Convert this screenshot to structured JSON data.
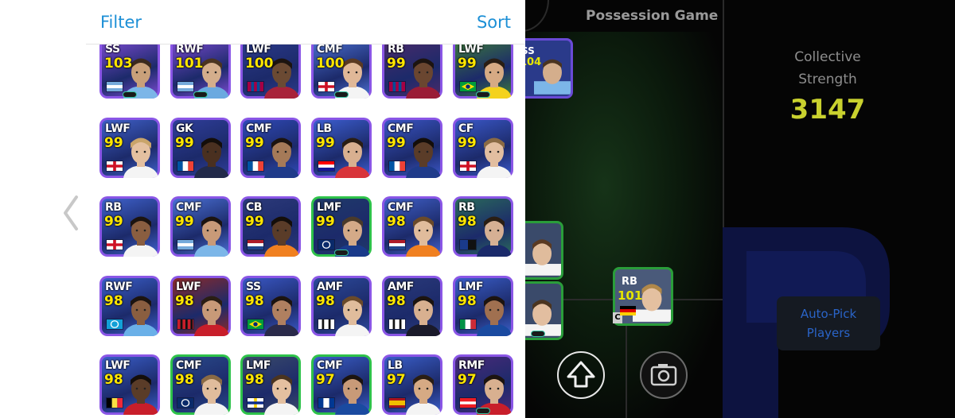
{
  "panel": {
    "filter_label": "Filter",
    "sort_label": "Sort",
    "cards": [
      {
        "pos": "SS",
        "rating": "103",
        "flag": "argentina",
        "bg": "#7a4ad0",
        "border": "#8a56e6",
        "skin": "#c9a07a",
        "hair": "#3b2a1e",
        "shirt": "#7cb6e8",
        "badge": true
      },
      {
        "pos": "RWF",
        "rating": "101",
        "flag": "argentina",
        "bg": "#7a4ad0",
        "border": "#8a56e6",
        "skin": "#d4ae8c",
        "hair": "#4a3420",
        "shirt": "#6aa9e0",
        "badge": true
      },
      {
        "pos": "LWF",
        "rating": "100",
        "flag": "barcelona",
        "bg": "#2b3a8a",
        "border": "#8a56e6",
        "skin": "#6b4a33",
        "hair": "#1c1410",
        "shirt": "#a8223a",
        "badge": false
      },
      {
        "pos": "CMF",
        "rating": "100",
        "flag": "england",
        "bg": "#4b6fd0",
        "border": "#8a56e6",
        "skin": "#e0b898",
        "hair": "#5a3a22",
        "shirt": "#f4f4f4",
        "badge": true
      },
      {
        "pos": "RB",
        "rating": "99",
        "flag": "barcelona",
        "bg": "#4a2a6a",
        "border": "#8a56e6",
        "skin": "#6a4630",
        "hair": "#1c1410",
        "shirt": "#9a1c36",
        "badge": false
      },
      {
        "pos": "LWF",
        "rating": "99",
        "flag": "brazil",
        "bg": "#3c7a3a",
        "border": "#8a56e6",
        "skin": "#d6aa84",
        "hair": "#2a1e14",
        "shirt": "#f4d21c",
        "badge": true
      },
      {
        "pos": "LWF",
        "rating": "99",
        "flag": "england",
        "bg": "#3f60c8",
        "border": "#8a56e6",
        "skin": "#e4c0a0",
        "hair": "#c9a46a",
        "shirt": "#f4f4f4",
        "badge": false
      },
      {
        "pos": "GK",
        "rating": "99",
        "flag": "france",
        "bg": "#2f3e9a",
        "border": "#8a56e6",
        "skin": "#4a3020",
        "hair": "#140e0a",
        "shirt": "#222a4a",
        "badge": false
      },
      {
        "pos": "CMF",
        "rating": "99",
        "flag": "france",
        "bg": "#2f4ab8",
        "border": "#8a56e6",
        "skin": "#a57a58",
        "hair": "#1c1410",
        "shirt": "#1f3b8a",
        "badge": false
      },
      {
        "pos": "LB",
        "rating": "99",
        "flag": "croatia",
        "bg": "#3c5ed0",
        "border": "#8a56e6",
        "skin": "#d8b090",
        "hair": "#2a1e14",
        "shirt": "#d8343a",
        "badge": false
      },
      {
        "pos": "CMF",
        "rating": "99",
        "flag": "france",
        "bg": "#3a55c4",
        "border": "#8a56e6",
        "skin": "#5a3c28",
        "hair": "#140e0a",
        "shirt": "#1f3b8a",
        "badge": false
      },
      {
        "pos": "CF",
        "rating": "99",
        "flag": "england",
        "bg": "#3a58c8",
        "border": "#8a56e6",
        "skin": "#e2bea0",
        "hair": "#8a6a44",
        "shirt": "#f4f4f4",
        "badge": false
      },
      {
        "pos": "RB",
        "rating": "99",
        "flag": "england",
        "bg": "#3f62cc",
        "border": "#8a56e6",
        "skin": "#8a5e40",
        "hair": "#1c1410",
        "shirt": "#f4f4f4",
        "badge": false
      },
      {
        "pos": "CMF",
        "rating": "99",
        "flag": "argentina",
        "bg": "#4a70d4",
        "border": "#8a56e6",
        "skin": "#c89a78",
        "hair": "#1c1410",
        "shirt": "#7cb6e8",
        "badge": false
      },
      {
        "pos": "CB",
        "rating": "99",
        "flag": "netherlands",
        "bg": "#2c3a7a",
        "border": "#8a56e6",
        "skin": "#5a3c28",
        "hair": "#140e0a",
        "shirt": "#f08020",
        "badge": false
      },
      {
        "pos": "LMF",
        "rating": "99",
        "flag": "inter",
        "bg": "#203a6a",
        "border": "#2ec24a",
        "skin": "#d4aa88",
        "hair": "#4a3a2a",
        "shirt": "#1a3a8a",
        "badge": true
      },
      {
        "pos": "CMF",
        "rating": "98",
        "flag": "netherlands",
        "bg": "#4060c8",
        "border": "#8a56e6",
        "skin": "#e0bc9c",
        "hair": "#6a4a2a",
        "shirt": "#f08020",
        "badge": false
      },
      {
        "pos": "RB",
        "rating": "98",
        "flag": "atalanta",
        "bg": "#2a6a5a",
        "border": "#8a56e6",
        "skin": "#d6b094",
        "hair": "#2a1e14",
        "shirt": "#1a2a6a",
        "badge": false
      },
      {
        "pos": "RWF",
        "rating": "98",
        "flag": "napoli",
        "bg": "#3a5ec8",
        "border": "#8a56e6",
        "skin": "#8a5e40",
        "hair": "#1c1410",
        "shirt": "#6ab0e8",
        "badge": false
      },
      {
        "pos": "LWF",
        "rating": "98",
        "flag": "milan",
        "bg": "#8a2a2a",
        "border": "#8a56e6",
        "skin": "#c89a78",
        "hair": "#2a1e14",
        "shirt": "#c81e2a",
        "badge": false
      },
      {
        "pos": "SS",
        "rating": "98",
        "flag": "brazil",
        "bg": "#3a58c4",
        "border": "#8a56e6",
        "skin": "#b08060",
        "hair": "#1c1410",
        "shirt": "#2a2a4a",
        "badge": false
      },
      {
        "pos": "AMF",
        "rating": "98",
        "flag": "udinese",
        "bg": "#2c4a9a",
        "border": "#8a56e6",
        "skin": "#e0bc9c",
        "hair": "#6a4a2a",
        "shirt": "#f4f4f4",
        "badge": false
      },
      {
        "pos": "AMF",
        "rating": "98",
        "flag": "udinese",
        "bg": "#2a3a7a",
        "border": "#8a56e6",
        "skin": "#d8b090",
        "hair": "#1c1410",
        "shirt": "#1a1a2a",
        "badge": false
      },
      {
        "pos": "LMF",
        "rating": "98",
        "flag": "italy",
        "bg": "#3a5ec8",
        "border": "#8a56e6",
        "skin": "#a07050",
        "hair": "#1c1410",
        "shirt": "#1a4aa0",
        "badge": false
      },
      {
        "pos": "LWF",
        "rating": "98",
        "flag": "belgium",
        "bg": "#3a5ec8",
        "border": "#8a56e6",
        "skin": "#5a3c28",
        "hair": "#140e0a",
        "shirt": "#c81e2a",
        "badge": false
      },
      {
        "pos": "CMF",
        "rating": "98",
        "flag": "inter",
        "bg": "#2a4a8a",
        "border": "#2ec24a",
        "skin": "#e0bc9c",
        "hair": "#8a6a44",
        "shirt": "#f4f4f4",
        "badge": false
      },
      {
        "pos": "LMF",
        "rating": "98",
        "flag": "parma",
        "bg": "#3a4a6a",
        "border": "#2ec24a",
        "skin": "#e4c0a0",
        "hair": "#4a3420",
        "shirt": "#f4f4f4",
        "badge": false
      },
      {
        "pos": "CMF",
        "rating": "97",
        "flag": "porto",
        "bg": "#3a5ec8",
        "border": "#2ec24a",
        "skin": "#c89a78",
        "hair": "#1c1410",
        "shirt": "#1a4aa0",
        "badge": false
      },
      {
        "pos": "LB",
        "rating": "97",
        "flag": "spain",
        "bg": "#3a5ec8",
        "border": "#8a56e6",
        "skin": "#d6aa84",
        "hair": "#2a1e14",
        "shirt": "#f4f4f4",
        "badge": false
      },
      {
        "pos": "RMF",
        "rating": "97",
        "flag": "psv",
        "bg": "#4a2a7a",
        "border": "#8a56e6",
        "skin": "#d8b090",
        "hair": "#1c1410",
        "shirt": "#c81e2a",
        "badge": true
      }
    ]
  },
  "field": {
    "title": "Possession Game",
    "strength_label_1": "Collective",
    "strength_label_2": "Strength",
    "strength_value": "3147",
    "autopick_line_1": "Auto-Pick",
    "autopick_line_2": "Players",
    "rb_card": {
      "pos": "RB",
      "rating": "101",
      "flag": "germany"
    },
    "captain_tag": "C",
    "peek_card_pos": "SS",
    "peek_card_rating": "104"
  },
  "icons": {
    "back": "chevron-left-icon",
    "upload": "arrow-up-icon",
    "camera": "camera-icon"
  }
}
